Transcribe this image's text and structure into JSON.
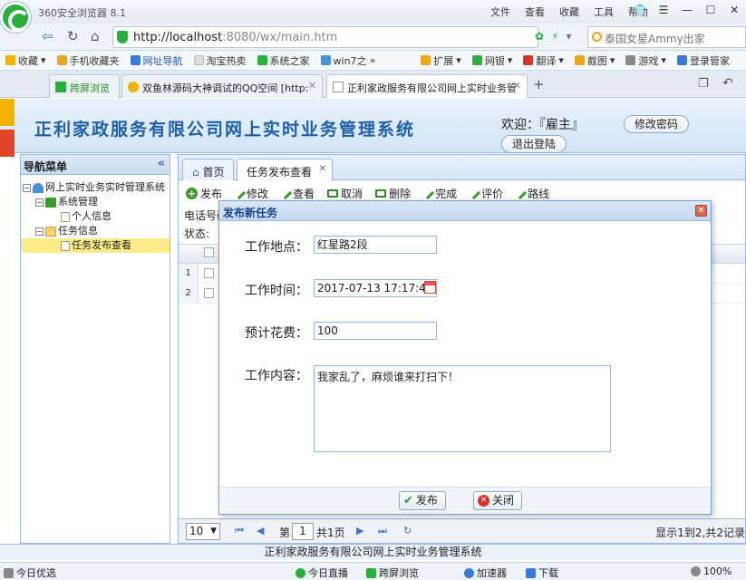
{
  "browser": {
    "title": "360安全浏览器 8.1",
    "menu": [
      "文件",
      "查看",
      "收藏",
      "工具",
      "帮助"
    ],
    "url_host": "http://localhost",
    "url_rest": ":8080/wx/main.htm",
    "search_text": "泰国女星Ammy出家",
    "favorites": [
      "收藏",
      "手机收藏夹",
      "网址导航",
      "淘宝热卖",
      "系统之家",
      "win7之"
    ],
    "extensions": [
      "扩展",
      "网银",
      "翻译",
      "截图",
      "游戏",
      "登录管家"
    ],
    "tabs": [
      "跨屏浏览",
      "双鱼林源码大神调试的QQ空间 [http:",
      "正利家政服务有限公司网上实时业务管"
    ]
  },
  "app": {
    "system_title": "正利家政服务有限公司网上实时业务管理系统",
    "welcome": "欢迎：『雇主』",
    "change_password": "修改密码",
    "logout": "退出登陆",
    "footer": "正利家政服务有限公司网上实时业务管理系统"
  },
  "nav": {
    "title": "导航菜单",
    "root": "网上实时业务实时管理系统",
    "group1": "系统管理",
    "item_personal": "个人信息",
    "group2": "任务信息",
    "item_task": "任务发布查看"
  },
  "center": {
    "tab_home": "首页",
    "tab_task": "任务发布查看",
    "toolbar": [
      "发布",
      "修改",
      "查看",
      "取消",
      "删除",
      "完成",
      "评价",
      "路线"
    ],
    "filter_phone": "电话号码",
    "filter_status": "状态:",
    "rows": [
      "1",
      "2"
    ]
  },
  "pager": {
    "page_size": "10",
    "page_label": "第",
    "page_value": "1",
    "total_pages": "共1页",
    "info": "显示1到2,共2记录"
  },
  "dialog": {
    "title": "发布新任务",
    "location_label": "工作地点：",
    "location_value": "红星路2段",
    "time_label": "工作时间：",
    "time_value": "2017-07-13 17:17:41",
    "cost_label": "预计花费：",
    "cost_value": "100",
    "content_label": "工作内容：",
    "content_value": "我家乱了，麻烦谁来打扫下！",
    "publish_btn": "发布",
    "close_btn": "关闭"
  },
  "statusbar": {
    "left": "今日优选",
    "items": [
      "今日直播",
      "跨屏浏览",
      "加速器",
      "下载",
      "100%"
    ]
  },
  "colors": {
    "accent": "#1f5fa8",
    "panel_border": "#99bbe8",
    "selected": "#fbec88"
  }
}
